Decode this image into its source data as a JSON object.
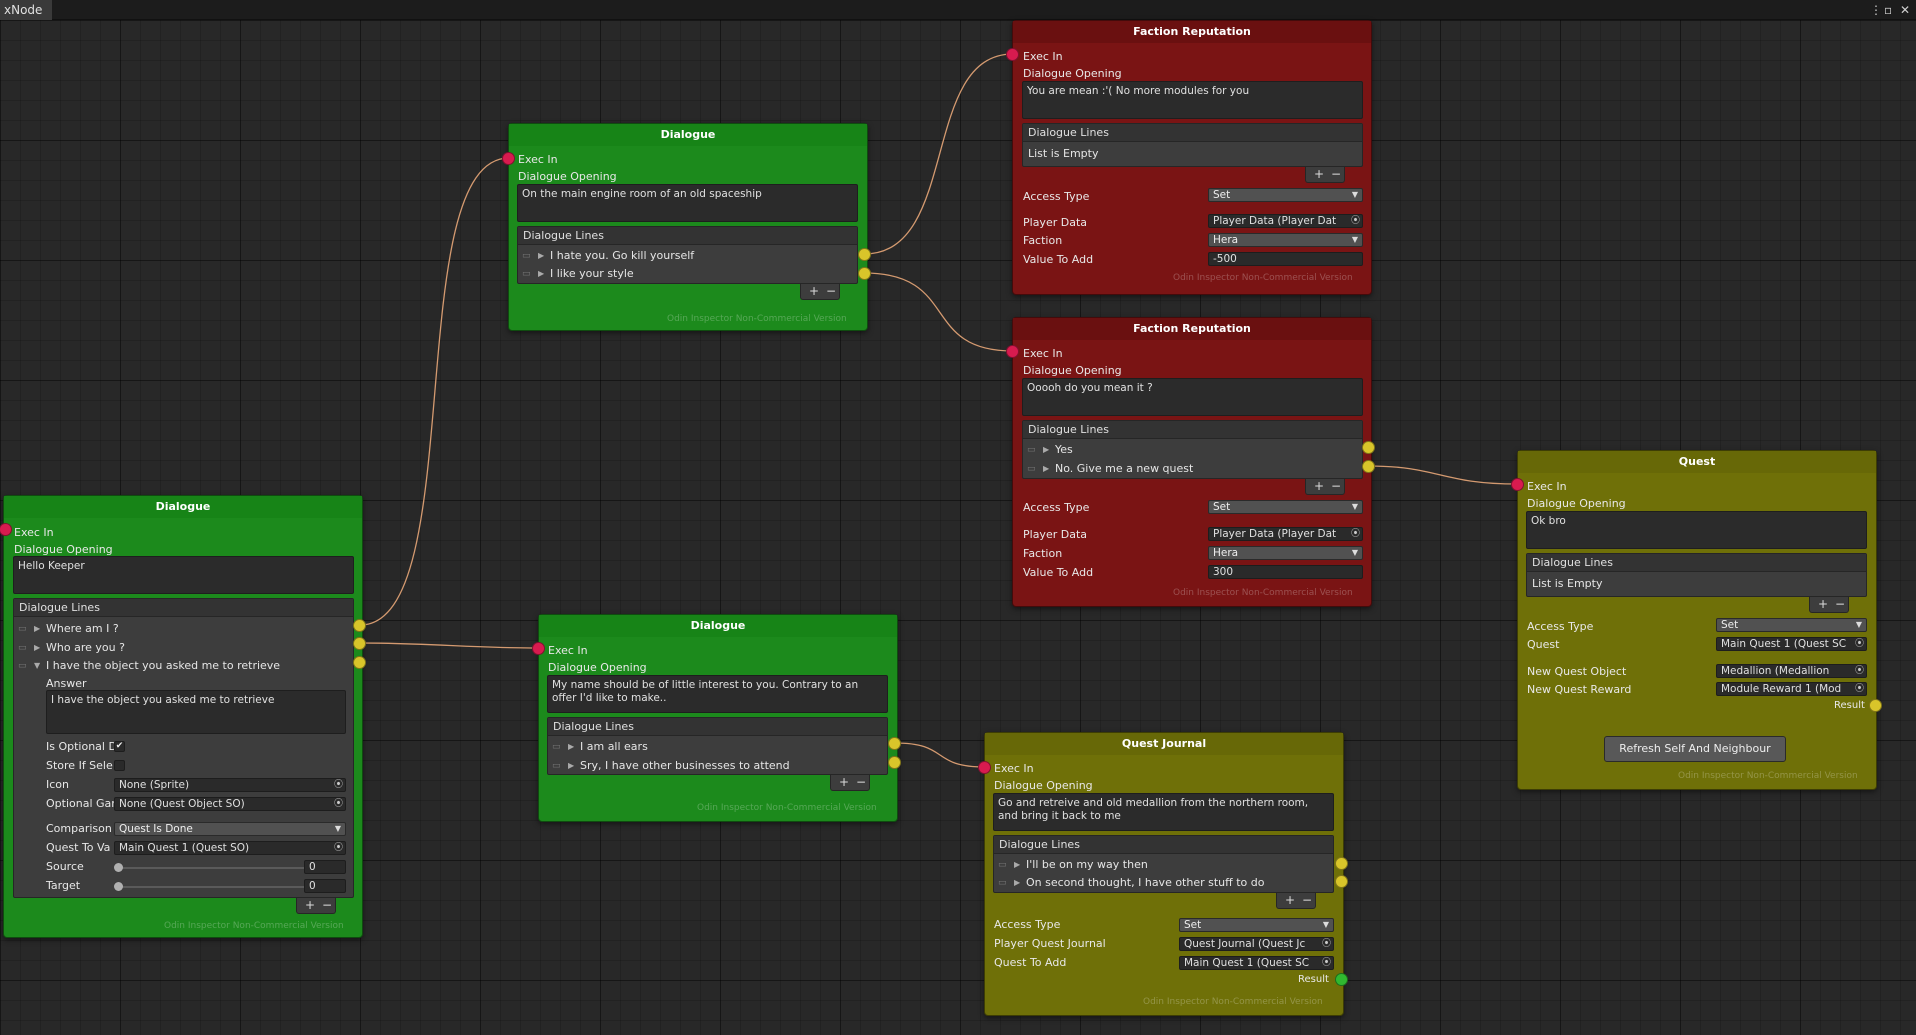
{
  "window": {
    "tab_label": "xNode",
    "menu_glyph": "⋮",
    "max_glyph": "▫",
    "close_glyph": "✕"
  },
  "common": {
    "exec_in": "Exec In",
    "dialogue_opening": "Dialogue Opening",
    "dialogue_lines": "Dialogue Lines",
    "list_empty": "List is Empty",
    "plus": "+",
    "minus": "−",
    "footer": "Odin Inspector Non-Commercial Version",
    "result": "Result",
    "access_type": "Access Type",
    "player_data": "Player Data",
    "faction": "Faction",
    "value_to_add": "Value To Add",
    "quest": "Quest",
    "new_quest_object": "New Quest Object",
    "new_quest_reward": "New Quest Reward",
    "player_quest_journal": "Player Quest Journal",
    "quest_to_add": "Quest To Add"
  },
  "dialogue_left": {
    "title": "Dialogue",
    "opening": "Hello Keeper",
    "lines": [
      "Where am I ?",
      "Who are you ?",
      "I have the object you asked me to retrieve"
    ],
    "answer_label": "Answer",
    "answer": "I have the object you asked me to retrieve",
    "is_optional_label": "Is Optional D",
    "is_optional_checked": true,
    "store_label": "Store If Sele",
    "icon_label": "Icon",
    "icon_value": "None (Sprite)",
    "optional_label": "Optional Gar",
    "optional_value": "None (Quest Object SO)",
    "comparison_label": "Comparison",
    "comparison_value": "Quest Is Done",
    "quest_to_va_label": "Quest To Va",
    "quest_to_va_value": "Main Quest 1 (Quest SO)",
    "source_label": "Source",
    "source_value": "0",
    "target_label": "Target",
    "target_value": "0"
  },
  "dialogue_top": {
    "title": "Dialogue",
    "opening": "On the main engine room of an old spaceship",
    "lines": [
      "I hate you. Go kill yourself",
      "I like your style"
    ]
  },
  "dialogue_mid": {
    "title": "Dialogue",
    "opening": "My name should be of little interest to you. Contrary to an offer I'd like to make..",
    "lines": [
      "I am all ears",
      "Sry, I have other businesses to attend"
    ]
  },
  "faction1": {
    "title": "Faction Reputation",
    "opening": "You are mean :'( No more modules for you",
    "access_value": "Set",
    "player_data_value": "Player Data (Player Dat",
    "faction_value": "Hera",
    "value": "-500"
  },
  "faction2": {
    "title": "Faction Reputation",
    "opening": "Ooooh do you mean it ?",
    "lines": [
      "Yes",
      "No. Give me a new quest"
    ],
    "access_value": "Set",
    "player_data_value": "Player Data (Player Dat",
    "faction_value": "Hera",
    "value": "300"
  },
  "quest": {
    "title": "Quest",
    "opening": "Ok bro",
    "access_value": "Set",
    "quest_value": "Main Quest 1 (Quest SC",
    "new_object_value": "Medallion (Medallion",
    "new_reward_value": "Module Reward 1 (Mod",
    "refresh_button": "Refresh Self And Neighbour"
  },
  "quest_journal": {
    "title": "Quest Journal",
    "opening": "Go and retreive and old medallion from the northern room, and bring it back to me",
    "lines": [
      "I'll be on my way then",
      "On second thought, I have other stuff to do"
    ],
    "access_value": "Set",
    "journal_value": "Quest Journal (Quest Jc",
    "quest_to_add_value": "Main Quest 1 (Quest SC"
  },
  "colors": {
    "dialogue_node": "#1c8a1c",
    "faction_node": "#7a1414",
    "quest_node": "#6f7008",
    "input_port": "#d81b4f",
    "output_port": "#d9c52a",
    "result_port": "#30b830"
  }
}
